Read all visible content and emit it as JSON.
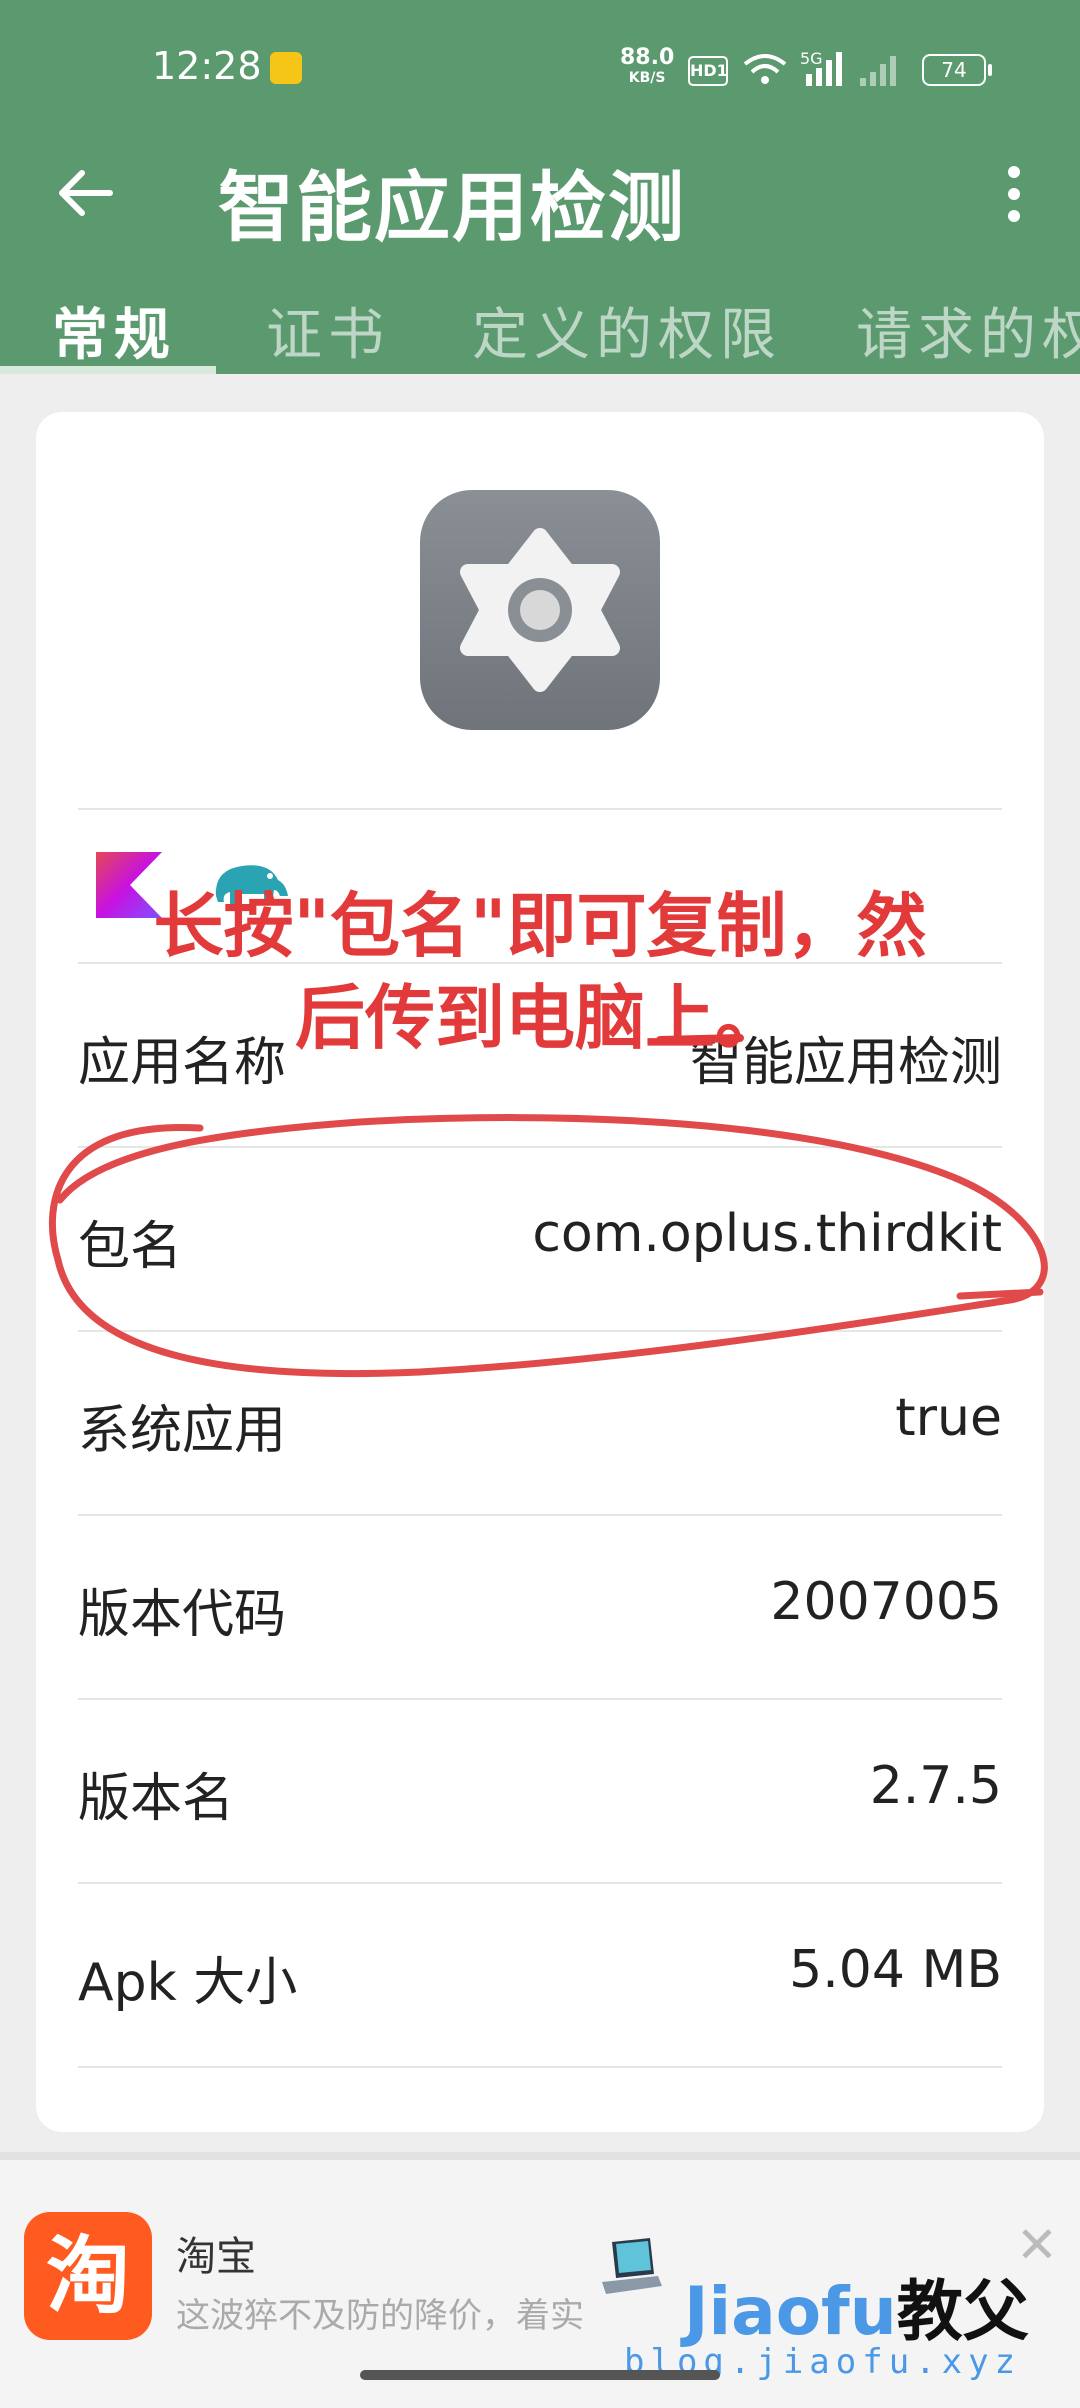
{
  "status_bar": {
    "time": "12:28",
    "net_speed": "88.0",
    "net_unit": "KB/S",
    "hd": "HD1",
    "signal": "5G",
    "battery": "74"
  },
  "app_bar": {
    "title": "智能应用检测",
    "tabs": [
      "常规",
      "证书",
      "定义的权限",
      "请求的权"
    ]
  },
  "annotation": "长按\"包名\"即可复制，然后传到电脑上。",
  "rows": [
    {
      "key": "应用名称",
      "value": "智能应用检测"
    },
    {
      "key": "包名",
      "value": "com.oplus.thirdkit"
    },
    {
      "key": "系统应用",
      "value": "true"
    },
    {
      "key": "版本代码",
      "value": "2007005"
    },
    {
      "key": "版本名",
      "value": "2.7.5"
    },
    {
      "key": "Apk 大小",
      "value": "5.04 MB"
    }
  ],
  "ad": {
    "logo_text": "淘",
    "name": "淘宝",
    "desc": "这波猝不及防的降价，着实"
  },
  "watermark": {
    "title_en": "Jiaofu",
    "title_cn": "教父",
    "url": "blog.jiaofu.xyz"
  },
  "colors": {
    "app_bar": "#5b9a6f",
    "annotation": "#e23a3a",
    "taobao": "#ff5a1f"
  }
}
